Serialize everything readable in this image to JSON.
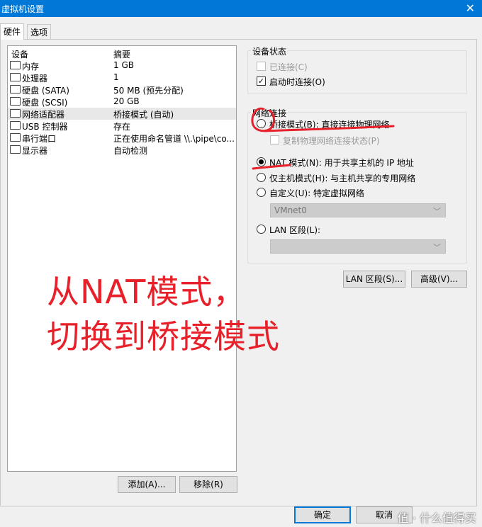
{
  "window": {
    "title": "虚拟机设置",
    "close_glyph": "✕"
  },
  "tabs": [
    {
      "label": "硬件"
    },
    {
      "label": "选项"
    }
  ],
  "device_list": {
    "headers": {
      "device": "设备",
      "summary": "摘要"
    },
    "rows": [
      {
        "name": "内存",
        "summary": "1 GB",
        "icon": "memory-icon"
      },
      {
        "name": "处理器",
        "summary": "1",
        "icon": "processor-icon"
      },
      {
        "name": "硬盘 (SATA)",
        "summary": "50 MB (预先分配)",
        "icon": "hard-disk-icon"
      },
      {
        "name": "硬盘 (SCSI)",
        "summary": "20 GB",
        "icon": "hard-disk-icon"
      },
      {
        "name": "网络适配器",
        "summary": "桥接模式 (自动)",
        "icon": "network-adapter-icon"
      },
      {
        "name": "USB 控制器",
        "summary": "存在",
        "icon": "usb-icon"
      },
      {
        "name": "串行端口",
        "summary": "正在使用命名管道 \\\\.\\pipe\\co...",
        "icon": "serial-port-icon"
      },
      {
        "name": "显示器",
        "summary": "自动检测",
        "icon": "display-icon"
      }
    ],
    "selected_index": 4
  },
  "buttons": {
    "add": "添加(A)...",
    "remove": "移除(R)",
    "lan_segments": "LAN 区段(S)...",
    "advanced": "高级(V)...",
    "ok": "确定",
    "cancel": "取消"
  },
  "device_status": {
    "title": "设备状态",
    "connected": {
      "label": "已连接(C)",
      "checked": false,
      "disabled": true
    },
    "connect_at_power_on": {
      "label": "启动时连接(O)",
      "checked": true
    }
  },
  "network_connection": {
    "title": "网络连接",
    "bridged": {
      "label": "桥接模式(B): 直接连接物理网络",
      "selected": false
    },
    "replicate_state": {
      "label": "复制物理网络连接状态(P)",
      "checked": false,
      "disabled": true
    },
    "nat": {
      "label": "NAT 模式(N): 用于共享主机的 IP 地址",
      "selected": true
    },
    "host_only": {
      "label": "仅主机模式(H): 与主机共享的专用网络",
      "selected": false
    },
    "custom": {
      "label": "自定义(U): 特定虚拟网络",
      "selected": false
    },
    "custom_select": {
      "value": "VMnet0"
    },
    "lan_segment": {
      "label": "LAN 区段(L):",
      "selected": false
    },
    "lan_select": {
      "value": ""
    }
  },
  "annotation": {
    "line1": "从NAT模式，",
    "line2": "切换到桥接模式",
    "color": "#e8202a"
  },
  "watermark": {
    "text": "值 · 什么值得买"
  },
  "colors": {
    "titlebar": "#0078d7",
    "accent": "#0078d7",
    "annotation_red": "#e8202a"
  }
}
